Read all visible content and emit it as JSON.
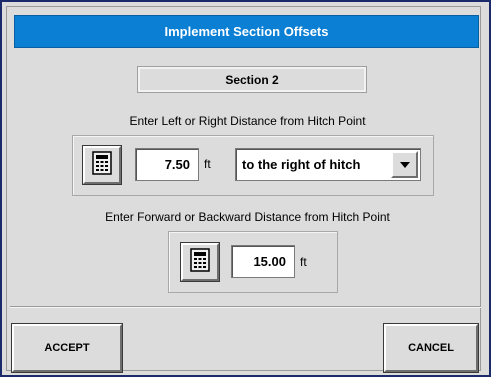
{
  "dialog": {
    "title": "Implement Section Offsets",
    "section_label": "Section 2"
  },
  "lateral": {
    "prompt": "Enter Left or Right Distance from Hitch Point",
    "value": "7.50",
    "unit": "ft",
    "direction": "to the right of hitch"
  },
  "longitudinal": {
    "prompt": "Enter Forward or Backward Distance from Hitch Point",
    "value": "15.00",
    "unit": "ft"
  },
  "buttons": {
    "accept": "ACCEPT",
    "cancel": "CANCEL"
  },
  "icons": {
    "calculator": "calculator-icon",
    "dropdown": "chevron-down-icon"
  },
  "colors": {
    "titlebar": "#0a7fd4",
    "dialog_bg": "#dcdcdc",
    "border": "#1a2a6a"
  }
}
